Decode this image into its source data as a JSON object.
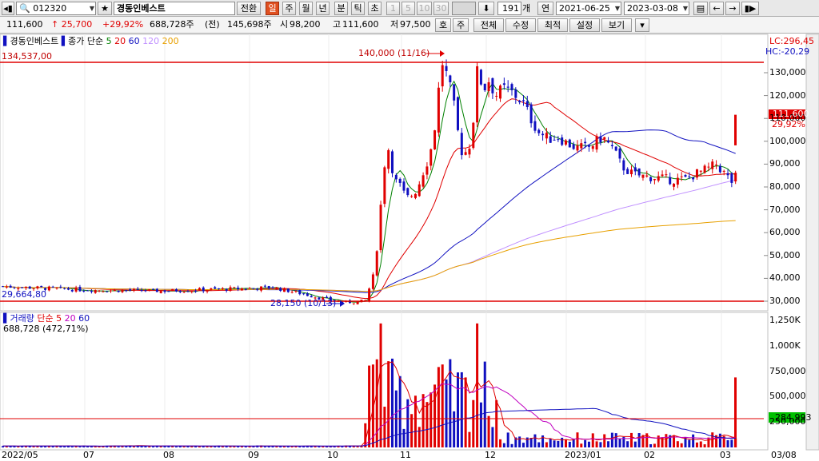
{
  "toolbar": {
    "code": "012320",
    "name": "경동인베스트",
    "convert_label": "전환",
    "periods": [
      "일",
      "주",
      "월",
      "년",
      "분",
      "틱",
      "초"
    ],
    "active_period": "일",
    "minute_buttons": [
      "1",
      "5",
      "10",
      "30"
    ],
    "count": "191",
    "count_unit": "개",
    "year_label": "연",
    "start_date": "2021-06-25",
    "end_date": "2023-03-08"
  },
  "quote": {
    "price": "111,600",
    "change": "↑ 25,700",
    "change_pct": "+29,92%",
    "volume": "688,728주",
    "prev_label": "(전)",
    "prev_volume": "145,698주",
    "open_label": "시",
    "open": "98,200",
    "high_label": "고",
    "high": "111,600",
    "low_label": "저",
    "low": "97,500",
    "buttons": [
      "호",
      "주",
      "전체",
      "수정",
      "최적",
      "설정",
      "보기"
    ]
  },
  "price_legend": {
    "name": "경동인베스트",
    "ma_label": "종가 단순",
    "periods": [
      "5",
      "20",
      "60",
      "120",
      "200"
    ],
    "colors": [
      "#008000",
      "#e00000",
      "#1010c0",
      "#c090ff",
      "#e8a000"
    ]
  },
  "price_axis": {
    "ticks": [
      "130,000",
      "120,000",
      "110,000",
      "100,000",
      "90,000",
      "80,000",
      "70,000",
      "60,000",
      "50,000",
      "40,000",
      "30,000"
    ],
    "lc": "LC:296,45",
    "hc": "HC:-20,29",
    "current_price": "111,600",
    "current_pct": "29,92%"
  },
  "annotations": {
    "top_line": "134,537,00",
    "bottom_line": "29,664,80",
    "high_label": "140,000 (11/16)",
    "low_label": "28,150 (10/13)"
  },
  "volume_legend": {
    "label": "거래량",
    "ma_label": "단순",
    "periods": [
      "5",
      "20",
      "60"
    ],
    "value": "688,728 (472,71%)"
  },
  "volume_axis": {
    "ticks": [
      "1,250K",
      "1,000K",
      "750,000",
      "500,000",
      "250,000"
    ],
    "current": "284,993"
  },
  "x_axis": {
    "ticks": [
      "2022/05",
      "07",
      "08",
      "09",
      "10",
      "11",
      "12",
      "2023/01",
      "02",
      "03",
      "03/08"
    ]
  },
  "chart_data": {
    "type": "candlestick",
    "title": "경동인베스트",
    "price_range": [
      24000,
      142000
    ],
    "volume_range": [
      0,
      1300000
    ],
    "x": [
      "2022/05",
      "07",
      "08",
      "09",
      "10",
      "11",
      "12",
      "2023/01",
      "02",
      "03"
    ],
    "series": [
      {
        "name": "5",
        "type": "ma"
      },
      {
        "name": "20",
        "type": "ma"
      },
      {
        "name": "60",
        "type": "ma"
      },
      {
        "name": "120",
        "type": "ma"
      },
      {
        "name": "200",
        "type": "ma"
      }
    ],
    "high": 140000,
    "high_date": "11/16",
    "low": 28150,
    "low_date": "10/13",
    "last_close": 111600
  }
}
